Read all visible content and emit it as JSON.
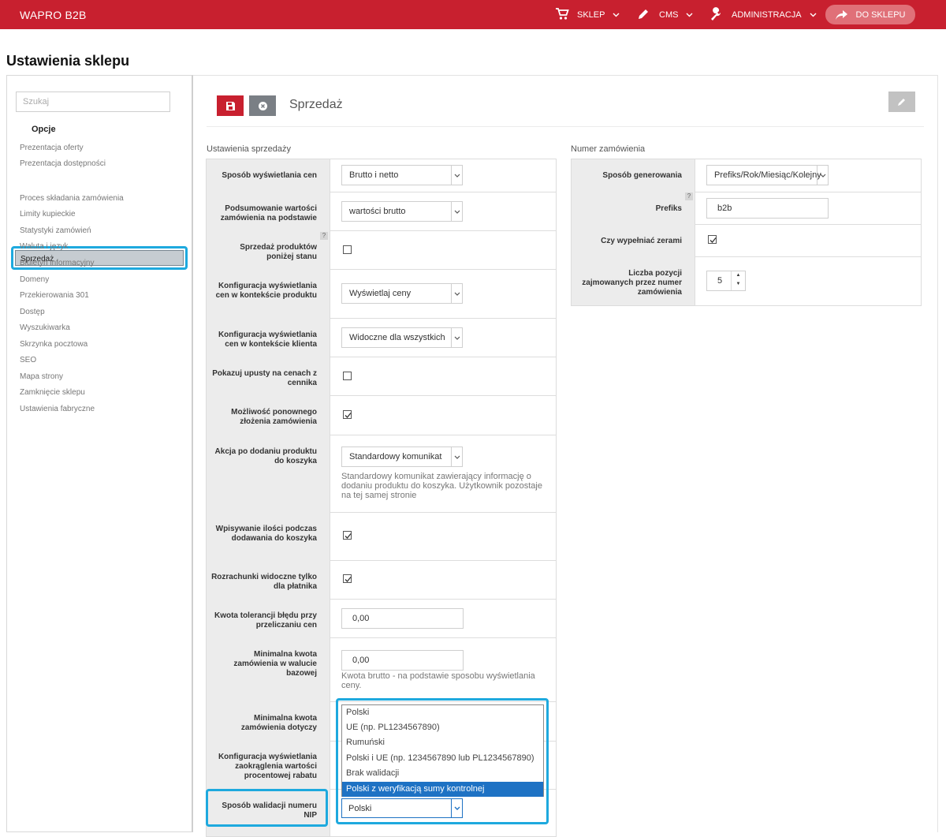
{
  "header": {
    "brand": "WAPRO B2B",
    "menu": [
      {
        "label": "SKLEP",
        "icon": "cart-icon"
      },
      {
        "label": "CMS",
        "icon": "pencil-icon"
      },
      {
        "label": "ADMINISTRACJA",
        "icon": "wrench-icon"
      }
    ],
    "shop_button": "DO SKLEPU",
    "color": "#c8202f"
  },
  "page_title": "Ustawienia sklepu",
  "sidebar": {
    "search_placeholder": "Szukaj",
    "heading": "Opcje",
    "items": [
      "Prezentacja oferty",
      "Prezentacja dostępności",
      "Sprzedaż",
      "Proces składania zamówienia",
      "Limity kupieckie",
      "Statystyki zamówień",
      "Waluta i język",
      "Biuletyn informacyjny",
      "Domeny",
      "Przekierowania 301",
      "Dostęp",
      "Wyszukiwarka",
      "Skrzynka pocztowa",
      "SEO",
      "Mapa strony",
      "Zamknięcie sklepu",
      "Ustawienia fabryczne"
    ],
    "active": "Sprzedaż"
  },
  "section": {
    "title": "Sprzedaż"
  },
  "sales": {
    "group_label": "Ustawienia sprzedaży",
    "rows": {
      "display_price": {
        "label": "Sposób wyświetlania cen",
        "value": "Brutto i netto"
      },
      "summary": {
        "label": "Podsumowanie wartości zamówienia na podstawie",
        "value": "wartości brutto"
      },
      "below_stock": {
        "label": "Sprzedaż produktów poniżej stanu",
        "checked": false,
        "help": "?"
      },
      "price_product": {
        "label": "Konfiguracja wyświetlania cen w kontekście produktu",
        "value": "Wyświetlaj ceny"
      },
      "price_client": {
        "label": "Konfiguracja wyświetlania cen w kontekście klienta",
        "value": "Widoczne dla wszystkich"
      },
      "discounts": {
        "label": "Pokazuj upusty na cenach z cennika",
        "checked": false
      },
      "reorder": {
        "label": "Możliwość ponownego złożenia zamówienia",
        "checked": true
      },
      "after_add": {
        "label": "Akcja po dodaniu produktu do koszyka",
        "value": "Standardowy komunikat",
        "hint": "Standardowy komunikat zawierający informację o dodaniu produktu do koszyka. Użytkownik pozostaje na tej samej stronie"
      },
      "qty_input": {
        "label": "Wpisywanie ilości podczas dodawania do koszyka",
        "checked": true
      },
      "settlements": {
        "label": "Rozrachunki widoczne tylko dla płatnika",
        "checked": true
      },
      "tolerance": {
        "label": "Kwota tolerancji błędu przy przeliczaniu cen",
        "value": "0,00"
      },
      "min_amount": {
        "label": "Minimalna kwota zamówienia w walucie bazowej",
        "value": "0,00",
        "hint": "Kwota brutto - na podstawie sposobu wyświetlania ceny."
      },
      "min_applies": {
        "label": "Minimalna kwota zamówienia dotyczy"
      },
      "rounding": {
        "label": "Konfiguracja wyświetlania zaokrąglenia wartości procentowej rabatu"
      },
      "nip": {
        "label": "Sposób walidacji numeru NIP",
        "value": "Polski"
      }
    },
    "nip_options": [
      "Polski",
      "UE (np. PL1234567890)",
      "Rumuński",
      "Polski i UE (np. 1234567890 lub PL1234567890)",
      "Brak walidacji",
      "Polski z weryfikacją sumy kontrolnej"
    ],
    "nip_highlighted": "Polski z weryfikacją sumy kontrolnej"
  },
  "order_number": {
    "group_label": "Numer zamówienia",
    "rows": {
      "generation": {
        "label": "Sposób generowania",
        "value": "Prefiks/Rok/Miesiąc/Kolejny"
      },
      "prefix": {
        "label": "Prefiks",
        "value": "b2b",
        "help": "?"
      },
      "zeros": {
        "label": "Czy wypełniać zerami",
        "checked": true
      },
      "positions": {
        "label": "Liczba pozycji zajmowanych przez numer zamówienia",
        "value": "5"
      }
    }
  },
  "colors": {
    "accent": "#c8202f",
    "highlight": "#1ea9de",
    "selection": "#1e72c4"
  }
}
